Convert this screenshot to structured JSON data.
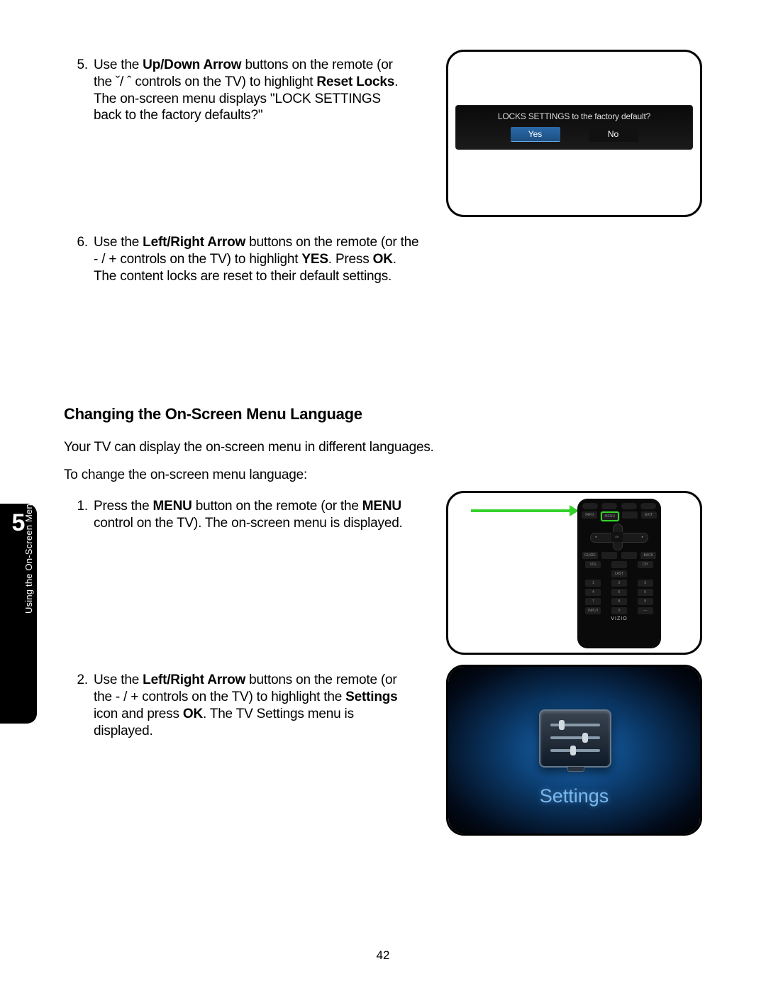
{
  "chapter": {
    "number": "5",
    "label": "Using the On-Screen Menu"
  },
  "steps_top": {
    "step5": {
      "num": "5.",
      "p1a": "Use the ",
      "b1": "Up/Down Arrow",
      "p1b": " buttons on the remote (or the ˇ/ ˆ controls on the TV) to highlight ",
      "b2": "Reset Locks",
      "p1c": ". The on-screen menu displays \"LOCK SETTINGS back to the factory defaults?\""
    },
    "step6": {
      "num": "6.",
      "p1a": "Use the ",
      "b1": "Left/Right Arrow",
      "p1b": " buttons on the remote (or the - / + controls on the TV) to highlight ",
      "b2": "YES",
      "p1c": ". Press ",
      "b3": "OK",
      "p1d": ". The content locks are reset to their default settings."
    }
  },
  "figure1": {
    "prompt": "LOCKS SETTINGS to the factory default?",
    "yes": "Yes",
    "no": "No"
  },
  "section": {
    "heading": "Changing the On-Screen Menu Language",
    "intro1": "Your TV can display the on-screen menu in different languages.",
    "intro2": "To change the on-screen menu language:"
  },
  "steps_lang": {
    "step1": {
      "num": "1.",
      "p1a": "Press the ",
      "b1": "MENU",
      "p1b": " button on the remote (or the ",
      "b2": "MENU",
      "p1c": " control on the TV). The on-screen menu is displayed."
    },
    "step2": {
      "num": "2.",
      "p1a": "Use the ",
      "b1": "Left/Right Arrow",
      "p1b": " buttons on the remote (or the - / + controls on the TV) to highlight the ",
      "b2": "Settings",
      "p1c": " icon and press ",
      "b3": "OK",
      "p1d": ". The TV Settings menu is displayed."
    }
  },
  "remote": {
    "brand": "VIZIO",
    "ok": "OK",
    "top": [
      "",
      "",
      "",
      ""
    ],
    "row2": [
      "INFO",
      "MENU",
      "",
      "EXIT"
    ],
    "row3": [
      "GUIDE",
      "",
      "",
      "BACK"
    ],
    "row4_left": "VOL",
    "row4_right": "CH",
    "last": "LAST",
    "keys": [
      [
        "1",
        "2",
        "3"
      ],
      [
        "4",
        "5",
        "6"
      ],
      [
        "7",
        "8",
        "9"
      ],
      [
        "INPUT",
        "0",
        "—"
      ]
    ]
  },
  "settings": {
    "label": "Settings"
  },
  "page": "42"
}
